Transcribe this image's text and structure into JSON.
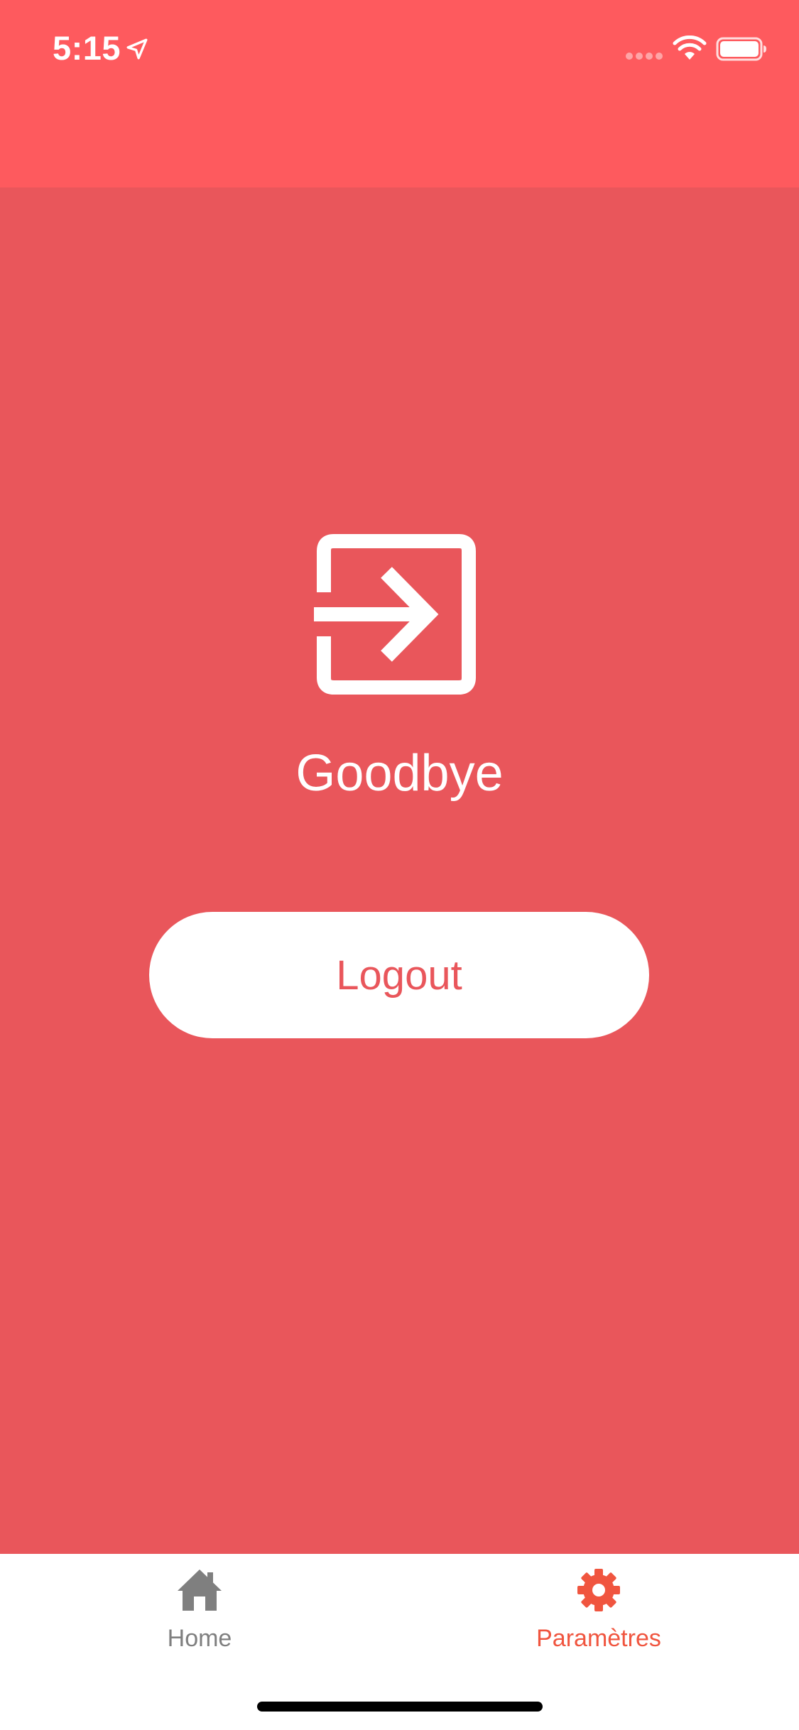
{
  "status_bar": {
    "time": "5:15",
    "icons": [
      "location-arrow-icon",
      "cellular-signal-icon",
      "wifi-icon",
      "battery-icon"
    ],
    "background": "#FE5A5E"
  },
  "main": {
    "icon": "logout-icon",
    "title": "Goodbye",
    "logout_button_label": "Logout",
    "background": "#E9565B"
  },
  "tab_bar": {
    "tabs": [
      {
        "label": "Home",
        "icon": "home-icon",
        "active": false,
        "color": "#7F7F7F"
      },
      {
        "label": "Paramètres",
        "icon": "gear-icon",
        "active": true,
        "color": "#F0553F"
      }
    ]
  }
}
